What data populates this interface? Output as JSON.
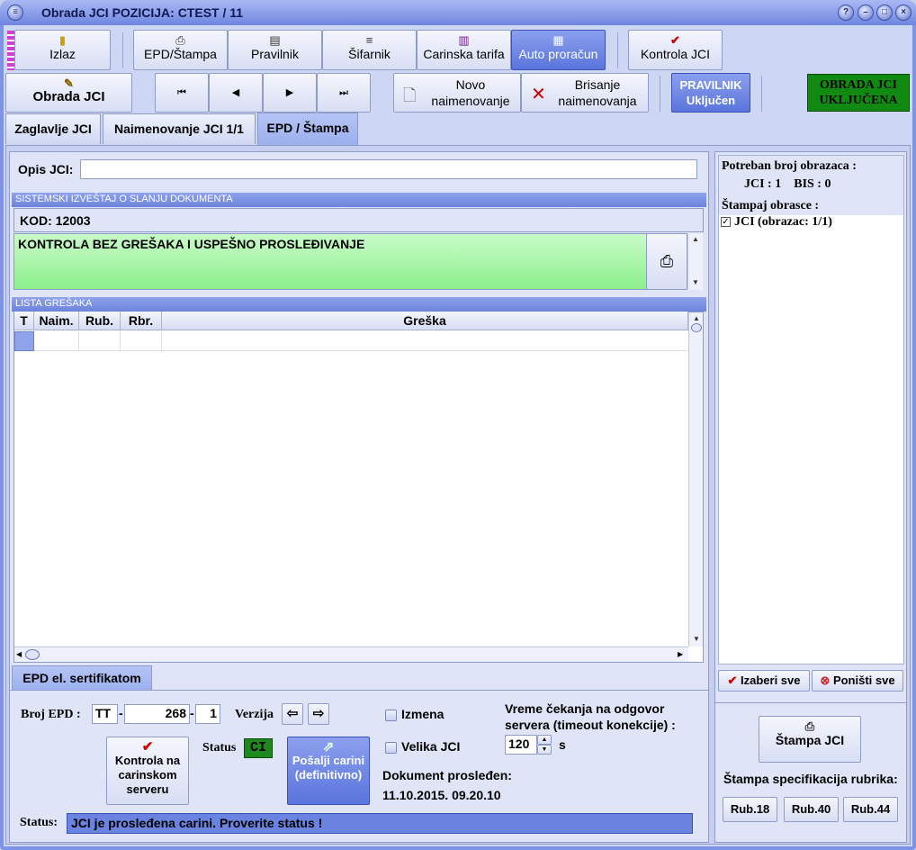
{
  "window": {
    "title": "Obrada JCI   POZICIJA: CTEST / 11"
  },
  "toolbar1": {
    "izlaz": "Izlaz",
    "epd_stampa": "EPD/Štampa",
    "pravilnik": "Pravilnik",
    "sifarnik": "Šifarnik",
    "carinska_tarifa": "Carinska tarifa",
    "auto_proracun": "Auto proračun",
    "kontrola_jci": "Kontrola JCI"
  },
  "toolbar2": {
    "obrada_jci": "Obrada JCI",
    "novo_l1": "Novo",
    "novo_l2": "naimenovanje",
    "brisanje_l1": "Brisanje",
    "brisanje_l2": "naimenovanja",
    "pravilnik_l1": "PRAVILNIK",
    "pravilnik_l2": "Uključen",
    "obrada_status_l1": "OBRADA JCI",
    "obrada_status_l2": "UKLJUČENA"
  },
  "tabs": [
    "Zaglavlje JCI",
    "Naimenovanje JCI 1/1",
    "EPD / Štampa"
  ],
  "opis": {
    "label": "Opis JCI:",
    "value": ""
  },
  "izvestaj": {
    "header": "SISTEMSKI IZVEŠTAJ O SLANJU DOKUMENTA",
    "kod": "KOD:  12003",
    "message": "KONTROLA BEZ GREŠAKA I USPEŠNO PROSLEĐIVANJE"
  },
  "greske": {
    "header": "LISTA GREŠAKA",
    "columns": [
      "T",
      "Naim.",
      "Rub.",
      "Rbr.",
      "Greška"
    ]
  },
  "epd": {
    "tab": "EPD el. sertifikatom",
    "broj_label": "Broj EPD :",
    "broj_1": "TT",
    "broj_2": "268",
    "broj_3": "1",
    "verzija_label": "Verzija",
    "izmena": "Izmena",
    "velika": "Velika JCI",
    "timeout_l1": "Vreme čekanja na odgovor",
    "timeout_l2": "servera (timeout konekcije) :",
    "timeout_value": "120",
    "timeout_unit": "s",
    "kontrola_l1": "Kontrola na",
    "kontrola_l2": "carinskom",
    "kontrola_l3": "serveru",
    "status_label": "Status",
    "status_value": "CI",
    "posalji_l1": "Pošalji carini",
    "posalji_l2": "(definitivno)",
    "prosledjen_label": "Dokument prosleđen:",
    "prosledjen_value": "11.10.2015. 09.20.10",
    "status_bar_label": "Status:",
    "status_bar_value": "JCI je prosleđena carini. Proverite status !"
  },
  "right": {
    "potreban": "Potreban broj obrazaca :",
    "jci_label": "JCI :",
    "jci_value": "1",
    "bis_label": "BIS :",
    "bis_value": "0",
    "stampaj": "Štampaj obrasce :",
    "item": "JCI (obrazac: 1/1)",
    "izaberi": "Izaberi sve",
    "ponisti": "Poništi sve",
    "stampa_jci": "Štampa JCI",
    "spec": "Štampa specifikacija rubrika:",
    "rub18": "Rub.18",
    "rub40": "Rub.40",
    "rub44": "Rub.44"
  },
  "colors": {
    "ok_green": "#9af59a",
    "status_blue": "#6a82e0",
    "ci_green": "#1e8a1e"
  }
}
